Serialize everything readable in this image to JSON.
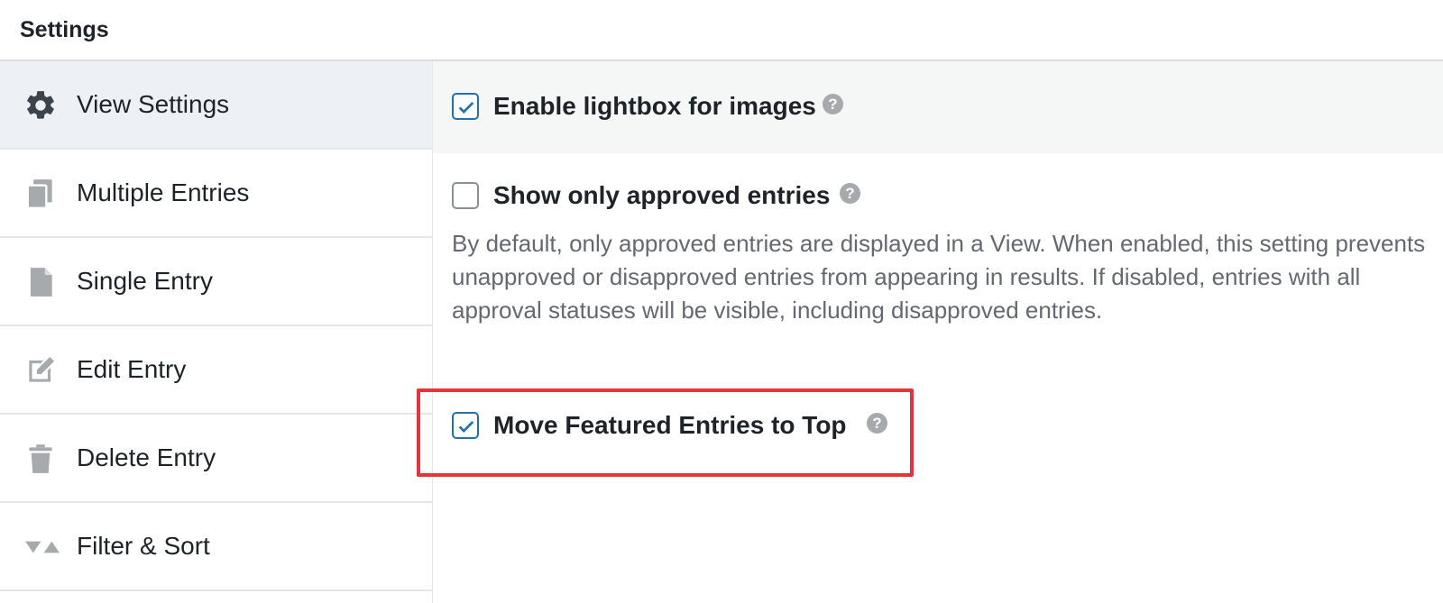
{
  "header": {
    "title": "Settings"
  },
  "sidebar": {
    "items": [
      {
        "label": "View Settings",
        "icon": "gear-icon",
        "active": true
      },
      {
        "label": "Multiple Entries",
        "icon": "copy-icon",
        "active": false
      },
      {
        "label": "Single Entry",
        "icon": "page-icon",
        "active": false
      },
      {
        "label": "Edit Entry",
        "icon": "edit-icon",
        "active": false
      },
      {
        "label": "Delete Entry",
        "icon": "trash-icon",
        "active": false
      },
      {
        "label": "Filter & Sort",
        "icon": "filter-sort-icon",
        "active": false
      }
    ]
  },
  "settings": {
    "lightbox": {
      "label": "Enable lightbox for images",
      "checked": true,
      "help": "?"
    },
    "approved": {
      "label": "Show only approved entries",
      "checked": false,
      "help": "?",
      "description": "By default, only approved entries are displayed in a View. When enabled, this setting prevents unapproved or disapproved entries from appearing in results. If disabled, entries with all approval statuses will be visible, including disapproved entries."
    },
    "featured": {
      "label": "Move Featured Entries to Top",
      "checked": true,
      "help": "?"
    }
  },
  "colors": {
    "accent": "#2271b1",
    "highlight": "#e0353d",
    "icon": "#a7aaad"
  }
}
